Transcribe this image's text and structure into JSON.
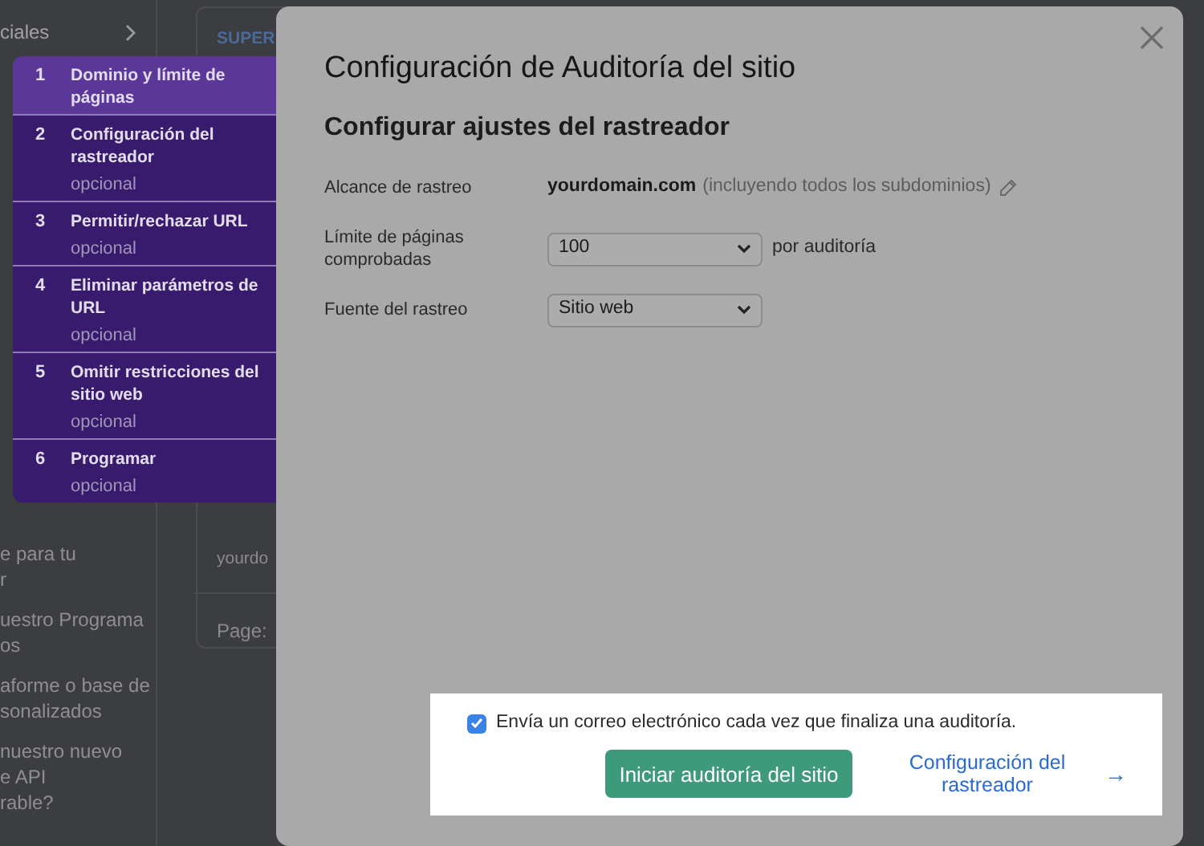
{
  "background_page": {
    "sidebar_top": {
      "label": "ciales"
    },
    "sidebar_paragraphs": [
      {
        "lines": [
          "e para tu",
          "r"
        ]
      },
      {
        "lines": [
          "uestro Programa",
          "os"
        ]
      },
      {
        "lines": [
          "aforme o base de",
          "sonalizados"
        ]
      },
      {
        "lines": [
          "nuestro nuevo",
          "e API",
          "rable?"
        ]
      }
    ],
    "card": {
      "heading": "SUPER",
      "domain": "yourdo",
      "pager": "Page:"
    }
  },
  "modal": {
    "title": "Configuración de Auditoría del sitio",
    "subtitle": "Configurar ajustes del rastreador",
    "fields": [
      {
        "kind": "text",
        "label": "Alcance de rastreo",
        "value": "yourdomain.com",
        "note": "(incluyendo todos los subdominios)"
      },
      {
        "kind": "select",
        "label": "Límite de páginas comprobadas",
        "value": "100",
        "suffix": "por auditoría"
      },
      {
        "kind": "select",
        "label": "Fuente del rastreo",
        "value": "Sitio web"
      }
    ],
    "email_option": {
      "label": "Envía un correo electrónico cada vez que finaliza una auditoría.",
      "checked": true
    },
    "primary_button": "Iniciar auditoría del sitio",
    "next_link": {
      "label": "Configuración del rastreador",
      "arrow": "→"
    }
  },
  "stepper": [
    {
      "number": "1",
      "title": "Dominio y límite de páginas",
      "selected": true
    },
    {
      "number": "2",
      "title": "Configuración del rastreador",
      "note": "opcional",
      "selected": false
    },
    {
      "number": "3",
      "title": "Permitir/rechazar URL",
      "note": "opcional",
      "selected": false
    },
    {
      "number": "4",
      "title": "Eliminar parámetros de URL",
      "note": "opcional",
      "selected": false
    },
    {
      "number": "5",
      "title": "Omitir restricciones del sitio web",
      "note": "opcional",
      "selected": false
    },
    {
      "number": "6",
      "title": "Programar",
      "note": "opcional",
      "selected": false
    }
  ]
}
